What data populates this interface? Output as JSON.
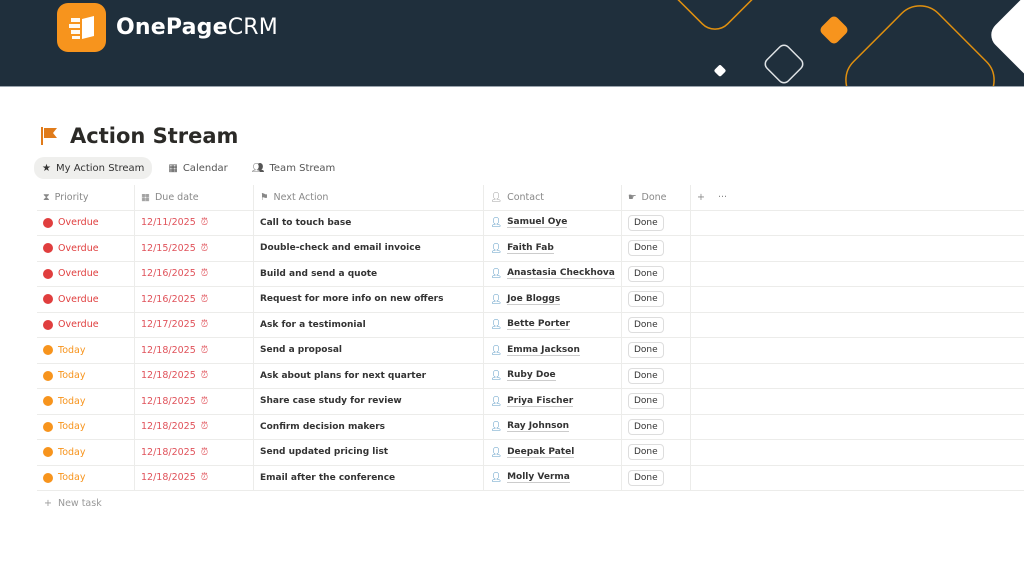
{
  "brand": {
    "name_bold": "OnePage",
    "name_light": "CRM"
  },
  "page": {
    "title": "Action Stream"
  },
  "tabs": [
    {
      "label": "My Action Stream",
      "icon": "star-icon"
    },
    {
      "label": "Calendar",
      "icon": "calendar-icon"
    },
    {
      "label": "Team Stream",
      "icon": "people-icon"
    }
  ],
  "columns": {
    "priority": "Priority",
    "due": "Due date",
    "next": "Next Action",
    "contact": "Contact",
    "done": "Done"
  },
  "colors": {
    "overdue": "#e03e3e",
    "today": "#f7941d",
    "accent": "#f7941d"
  },
  "rows": [
    {
      "priority": "Overdue",
      "due": "12/11/2025",
      "next": "Call to touch base",
      "contact": "Samuel Oye",
      "done": "Done"
    },
    {
      "priority": "Overdue",
      "due": "12/15/2025",
      "next": "Double-check and email invoice",
      "contact": "Faith Fab",
      "done": "Done"
    },
    {
      "priority": "Overdue",
      "due": "12/16/2025",
      "next": "Build and send a quote",
      "contact": "Anastasia Checkhova",
      "done": "Done"
    },
    {
      "priority": "Overdue",
      "due": "12/16/2025",
      "next": "Request for more info on new offers",
      "contact": "Joe Bloggs",
      "done": "Done"
    },
    {
      "priority": "Overdue",
      "due": "12/17/2025",
      "next": "Ask for a testimonial",
      "contact": "Bette Porter",
      "done": "Done"
    },
    {
      "priority": "Today",
      "due": "12/18/2025",
      "next": "Send a proposal",
      "contact": "Emma Jackson",
      "done": "Done"
    },
    {
      "priority": "Today",
      "due": "12/18/2025",
      "next": "Ask about plans for next quarter",
      "contact": "Ruby Doe",
      "done": "Done"
    },
    {
      "priority": "Today",
      "due": "12/18/2025",
      "next": "Share case study for review",
      "contact": "Priya Fischer",
      "done": "Done"
    },
    {
      "priority": "Today",
      "due": "12/18/2025",
      "next": "Confirm decision makers",
      "contact": "Ray Johnson",
      "done": "Done"
    },
    {
      "priority": "Today",
      "due": "12/18/2025",
      "next": "Send updated pricing list",
      "contact": "Deepak Patel",
      "done": "Done"
    },
    {
      "priority": "Today",
      "due": "12/18/2025",
      "next": "Email after the conference",
      "contact": "Molly Verma",
      "done": "Done"
    }
  ],
  "new_task": "New task"
}
